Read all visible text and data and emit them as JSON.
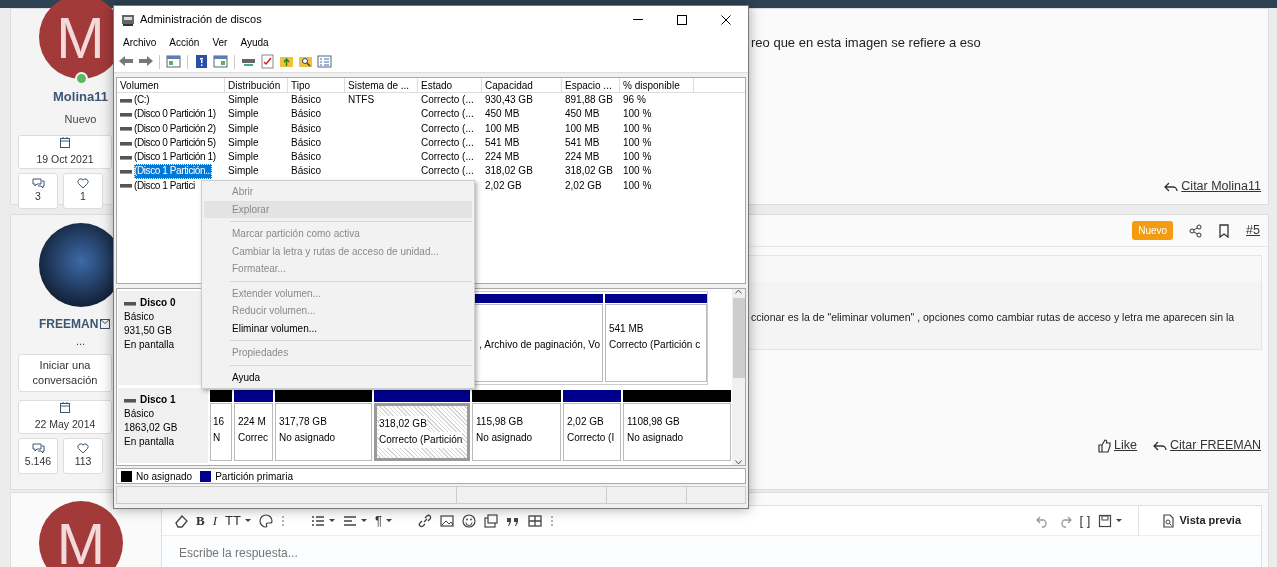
{
  "forum": {
    "posts": [
      {
        "avatar_letter": "M",
        "online": true,
        "username": "Molina11",
        "user_title": "Nuevo",
        "joined": "19 Oct 2021",
        "stats": [
          "3",
          "1"
        ],
        "message": "reo que en esta imagen se refiere a eso",
        "actions": [
          "Citar Molina11"
        ]
      },
      {
        "username": "FREEMAN",
        "user_extra": "...",
        "start_conversation": "Iniciar una conversación",
        "joined": "22 May 2014",
        "stats": [
          "5.146",
          "113"
        ],
        "badge": "Nuevo",
        "post_number": "#5",
        "quote_text": "ccionar es la de \"eliminar volumen\" , opciones como cambiar rutas de acceso y letra me aparecen sin la",
        "actions": [
          "Like",
          "Citar FREEMAN"
        ]
      }
    ],
    "reply": {
      "avatar_letter": "M",
      "glyphs": [
        "B",
        "I",
        "TT",
        "¶",
        "[ ]"
      ],
      "placeholder": "Escribe la respuesta...",
      "preview_button": "Vista previa"
    }
  },
  "window": {
    "title": "Administración de discos",
    "menu": [
      "Archivo",
      "Acción",
      "Ver",
      "Ayuda"
    ],
    "volumes": {
      "columns": [
        "Volumen",
        "Distribución",
        "Tipo",
        "Sistema de ...",
        "Estado",
        "Capacidad",
        "Espacio ...",
        "% disponible"
      ],
      "rows": [
        {
          "selected": false,
          "cells": [
            "(C:)",
            "Simple",
            "Básico",
            "NTFS",
            "Correcto (...",
            "930,43 GB",
            "891,88 GB",
            "96 %"
          ]
        },
        {
          "selected": false,
          "cells": [
            "(Disco 0 Partición 1)",
            "Simple",
            "Básico",
            null,
            "Correcto (...",
            "450 MB",
            "450 MB",
            "100 %"
          ]
        },
        {
          "selected": false,
          "cells": [
            "(Disco 0 Partición 2)",
            "Simple",
            "Básico",
            null,
            "Correcto (...",
            "100 MB",
            "100 MB",
            "100 %"
          ]
        },
        {
          "selected": false,
          "cells": [
            "(Disco 0 Partición 5)",
            "Simple",
            "Básico",
            null,
            "Correcto (...",
            "541 MB",
            "541 MB",
            "100 %"
          ]
        },
        {
          "selected": false,
          "cells": [
            "(Disco 1 Partición 1)",
            "Simple",
            "Básico",
            null,
            "Correcto (...",
            "224 MB",
            "224 MB",
            "100 %"
          ]
        },
        {
          "selected": true,
          "cells": [
            "(Disco 1 Partición...",
            "Simple",
            "Básico",
            null,
            "Correcto (...",
            "318,02 GB",
            "318,02 GB",
            "100 %"
          ]
        },
        {
          "selected": false,
          "cells": [
            "(Disco 1 Partici",
            null,
            null,
            null,
            null,
            "2,02 GB",
            "2,02 GB",
            "100 %"
          ]
        }
      ]
    },
    "disks": [
      {
        "name": "Disco 0",
        "type": "Básico",
        "size": "931,50 GB",
        "status": "En pantalla",
        "partitions": [
          {
            "kind": "primary",
            "selected": false,
            "status": ", Archivo de paginación, Vo"
          },
          {
            "kind": "primary",
            "selected": false,
            "size": "541 MB",
            "status": "Correcto (Partición c"
          }
        ]
      },
      {
        "name": "Disco 1",
        "type": "Básico",
        "size": "1863,02 GB",
        "status": "En pantalla",
        "partitions": [
          {
            "kind": "unallocated",
            "selected": false,
            "size": "16",
            "status": "N"
          },
          {
            "kind": "primary",
            "selected": false,
            "size": "224 M",
            "status": "Correc"
          },
          {
            "kind": "unallocated",
            "selected": false,
            "size": "317,78 GB",
            "status": "No asignado"
          },
          {
            "kind": "primary",
            "selected": true,
            "size": "318,02 GB",
            "status": "Correcto (Partición"
          },
          {
            "kind": "unallocated",
            "selected": false,
            "size": "115,98 GB",
            "status": "No asignado"
          },
          {
            "kind": "primary",
            "selected": false,
            "size": "2,02 GB",
            "status": "Correcto (I"
          },
          {
            "kind": "unallocated",
            "selected": false,
            "size": "1108,98 GB",
            "status": "No asignado"
          }
        ]
      }
    ],
    "legend": [
      {
        "kind": "unallocated",
        "label": "No asignado"
      },
      {
        "kind": "primary",
        "label": "Partición primaria"
      }
    ],
    "context_menu": [
      {
        "kind": "item",
        "label": "Abrir",
        "disabled": true,
        "highlighted": false
      },
      {
        "kind": "item",
        "label": "Explorar",
        "disabled": true,
        "highlighted": true
      },
      {
        "kind": "separator"
      },
      {
        "kind": "item",
        "label": "Marcar partición como activa",
        "disabled": true,
        "highlighted": false
      },
      {
        "kind": "item",
        "label": "Cambiar la letra y rutas de acceso de unidad...",
        "disabled": true,
        "highlighted": false
      },
      {
        "kind": "item",
        "label": "Formatear...",
        "disabled": true,
        "highlighted": false
      },
      {
        "kind": "separator"
      },
      {
        "kind": "item",
        "label": "Extender volumen...",
        "disabled": true,
        "highlighted": false
      },
      {
        "kind": "item",
        "label": "Reducir volumen...",
        "disabled": true,
        "highlighted": false
      },
      {
        "kind": "item",
        "label": "Eliminar volumen...",
        "disabled": false,
        "highlighted": false
      },
      {
        "kind": "separator"
      },
      {
        "kind": "item",
        "label": "Propiedades",
        "disabled": true,
        "highlighted": false
      },
      {
        "kind": "separator"
      },
      {
        "kind": "item",
        "label": "Ayuda",
        "disabled": false,
        "highlighted": false
      }
    ]
  }
}
